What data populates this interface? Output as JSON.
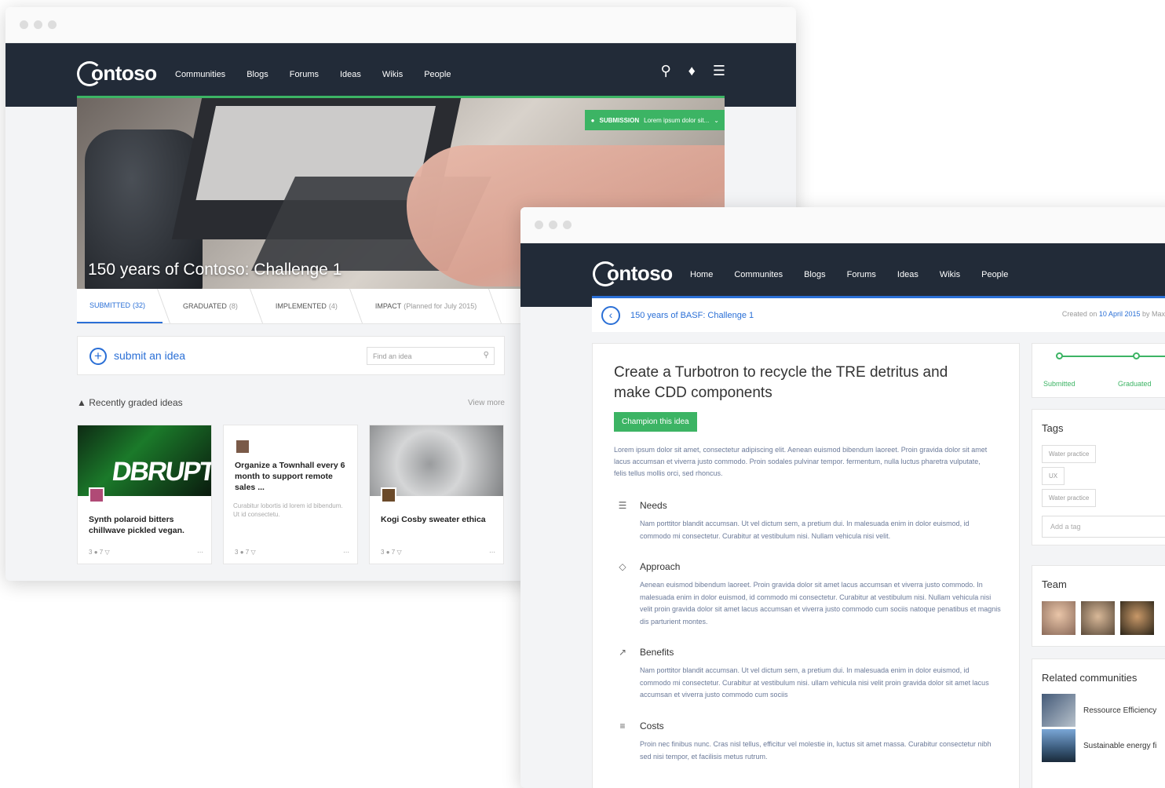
{
  "win1": {
    "nav": {
      "logo": "ontoso",
      "links": [
        "Communities",
        "Blogs",
        "Forums",
        "Ideas",
        "Wikis",
        "People"
      ]
    },
    "hero": {
      "title": "150 years of Contoso: Challenge 1",
      "badge_strong": "SUBMISSION",
      "badge_text": "Lorem ipsum dolor sit..."
    },
    "stages": [
      {
        "label": "SUBMITTED",
        "count": "(32)"
      },
      {
        "label": "GRADUATED",
        "count": "(8)"
      },
      {
        "label": "IMPLEMENTED",
        "count": "(4)"
      },
      {
        "label": "IMPACT",
        "count": "(Planned for July 2015)"
      }
    ],
    "submit": {
      "label": "submit an idea",
      "placeholder": "Find an idea"
    },
    "recent": {
      "title": "Recently graded ideas",
      "more": "View more"
    },
    "cards": [
      {
        "title": "Synth polaroid bitters chillwave pickled vegan.",
        "desc": "",
        "comments": "3",
        "votes": "7",
        "image_text": "DBRUPT"
      },
      {
        "title": "Organize a Townhall every 6 month to support remote sales ...",
        "desc": "Curabitur lobortis id lorem id bibendum. Ut id consectetu.",
        "comments": "3",
        "votes": "7"
      },
      {
        "title": "Kogi Cosby sweater ethica",
        "desc": "",
        "comments": "3",
        "votes": "7"
      }
    ]
  },
  "win2": {
    "nav": {
      "logo": "ontoso",
      "links": [
        "Home",
        "Communites",
        "Blogs",
        "Forums",
        "Ideas",
        "Wikis",
        "People"
      ]
    },
    "crumb": {
      "title": "150 years of BASF: Challenge 1",
      "created_prefix": "Created on",
      "created_date": "10 April 2015",
      "created_by": "by Max M"
    },
    "idea": {
      "title": "Create a Turbotron to recycle the TRE detritus and make CDD components",
      "champion": "Champion this idea",
      "lead": "Lorem ipsum dolor sit amet, consectetur adipiscing elit. Aenean euismod bibendum laoreet. Proin gravida dolor sit amet lacus accumsan et viverra justo commodo. Proin sodales pulvinar tempor. fermentum, nulla luctus pharetra vulputate, felis tellus mollis orci, sed rhoncus.",
      "sections": [
        {
          "title": "Needs",
          "icon": "list-icon",
          "body": "Nam porttitor blandit accumsan. Ut vel dictum sem, a pretium dui. In malesuada enim in dolor euismod, id commodo mi consectetur. Curabitur at vestibulum nisi. Nullam vehicula nisi velit."
        },
        {
          "title": "Approach",
          "icon": "diamond-icon",
          "body": "Aenean euismod bibendum laoreet. Proin gravida dolor sit amet lacus accumsan et viverra justo commodo. In malesuada enim in dolor euismod, id commodo mi consectetur. Curabitur at vestibulum nisi. Nullam vehicula nisi velit proin gravida dolor sit amet lacus accumsan et viverra justo commodo cum sociis natoque penatibus et magnis dis parturient montes."
        },
        {
          "title": "Benefits",
          "icon": "chart-icon",
          "body": "Nam porttitor blandit accumsan. Ut vel dictum sem, a pretium dui. In malesuada enim in dolor euismod, id commodo mi consectetur. Curabitur at vestibulum nisi. ullam vehicula nisi velit proin gravida dolor sit amet lacus accumsan et viverra justo commodo cum sociis"
        },
        {
          "title": "Costs",
          "icon": "coins-icon",
          "body": "Proin nec finibus nunc. Cras nisl tellus, efficitur vel molestie in, luctus sit amet massa. Curabitur consectetur nibh sed nisi tempor, et facilisis metus rutrum."
        }
      ]
    },
    "progress": {
      "steps": [
        "Submitted",
        "Graduated"
      ]
    },
    "tags": {
      "title": "Tags",
      "items": [
        "Water practice",
        "UX",
        "Water practice"
      ],
      "placeholder": "Add a tag"
    },
    "team": {
      "title": "Team"
    },
    "related": {
      "title": "Related communities",
      "items": [
        "Ressource Efficiency",
        "Sustainable energy fi"
      ]
    }
  }
}
